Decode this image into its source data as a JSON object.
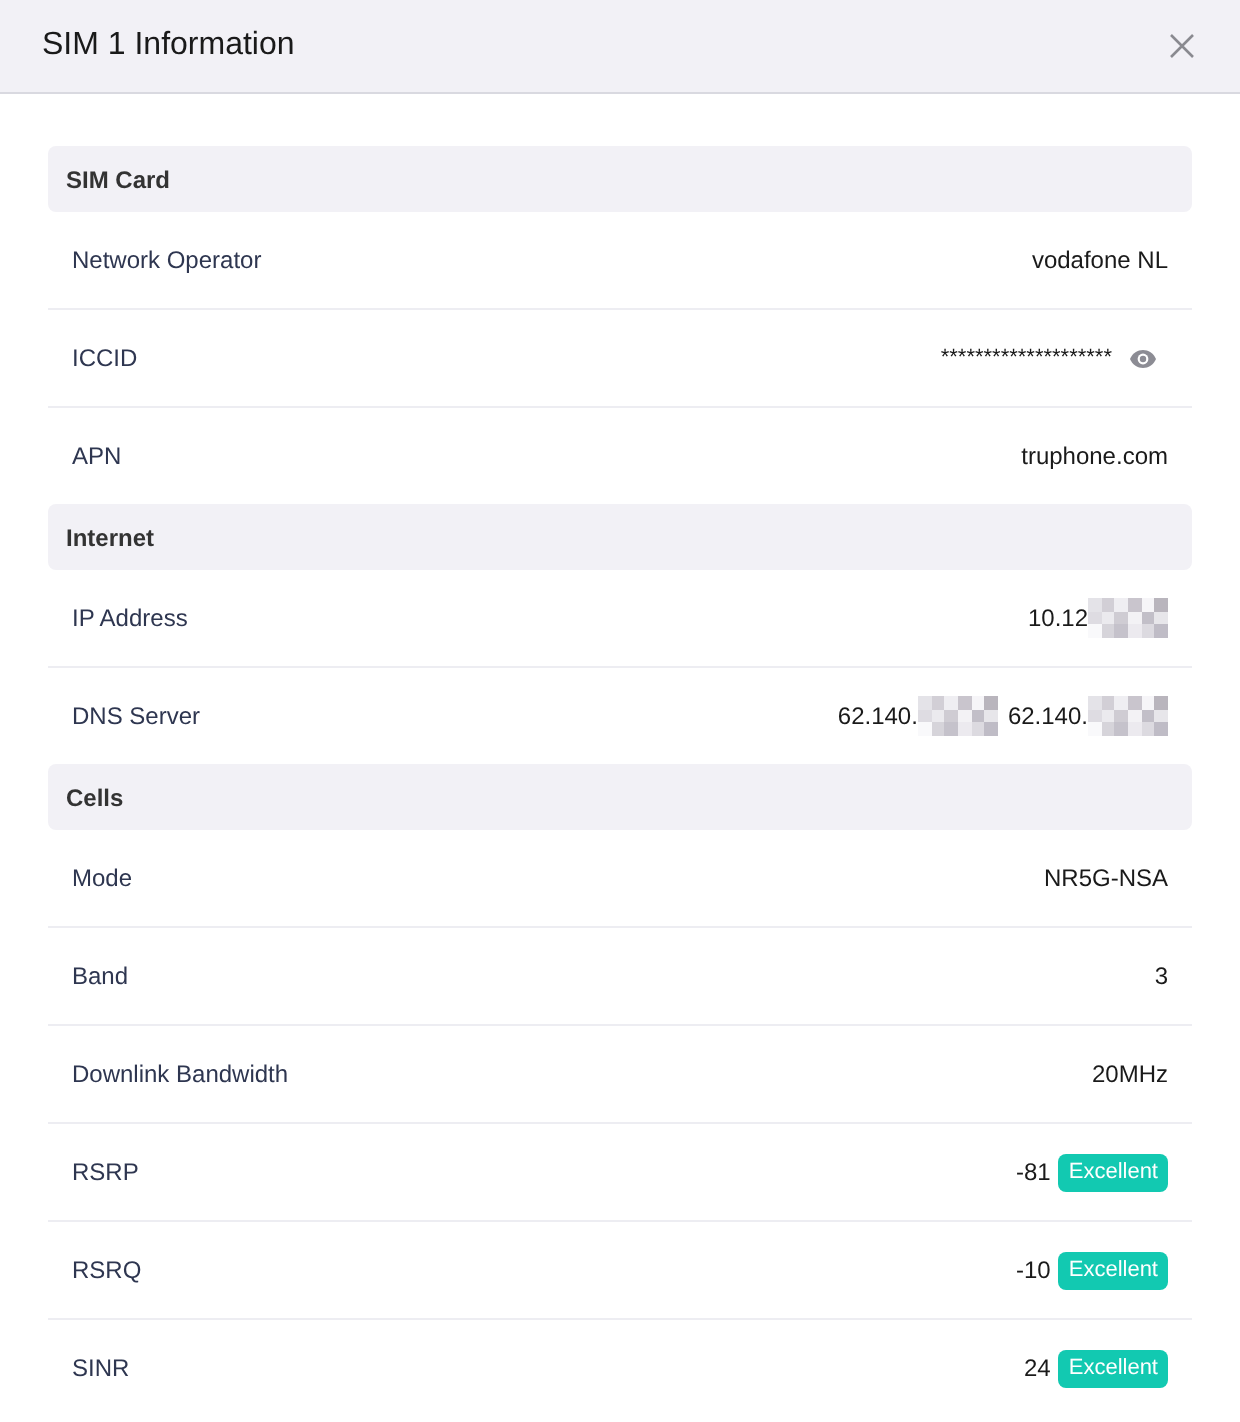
{
  "window": {
    "title": "SIM 1 Information"
  },
  "sections": [
    {
      "title": "SIM Card",
      "rows": [
        {
          "kind": "text",
          "label": "Network Operator",
          "value": "vodafone NL"
        },
        {
          "kind": "secret",
          "label": "ICCID",
          "value": "********************"
        },
        {
          "kind": "text",
          "label": "APN",
          "value": "truphone.com"
        }
      ]
    },
    {
      "title": "Internet",
      "rows": [
        {
          "kind": "partial",
          "label": "IP Address",
          "values": [
            "10.12"
          ]
        },
        {
          "kind": "partial",
          "label": "DNS Server",
          "values": [
            "62.140.",
            "62.140."
          ]
        }
      ]
    },
    {
      "title": "Cells",
      "rows": [
        {
          "kind": "text",
          "label": "Mode",
          "value": "NR5G-NSA"
        },
        {
          "kind": "text",
          "label": "Band",
          "value": "3"
        },
        {
          "kind": "text",
          "label": "Downlink Bandwidth",
          "value": "20MHz"
        },
        {
          "kind": "rating",
          "label": "RSRP",
          "value": "-81",
          "badge": "Excellent"
        },
        {
          "kind": "rating",
          "label": "RSRQ",
          "value": "-10",
          "badge": "Excellent"
        },
        {
          "kind": "rating",
          "label": "SINR",
          "value": "24",
          "badge": "Excellent"
        }
      ]
    }
  ]
}
